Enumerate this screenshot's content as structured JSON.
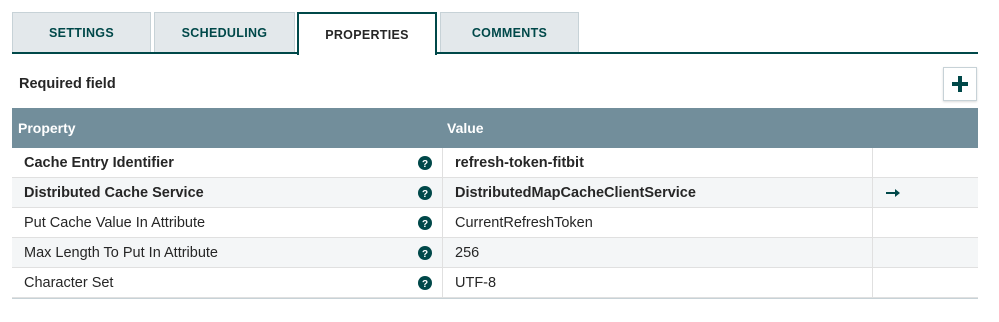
{
  "tabs": [
    {
      "label": "SETTINGS",
      "active": false
    },
    {
      "label": "SCHEDULING",
      "active": false
    },
    {
      "label": "PROPERTIES",
      "active": true
    },
    {
      "label": "COMMENTS",
      "active": false
    }
  ],
  "required_label": "Required field",
  "add_button_icon": "plus-icon",
  "grid": {
    "columns": [
      "Property",
      "Value"
    ],
    "rows": [
      {
        "name": "Cache Entry Identifier",
        "value": "refresh-token-fitbit",
        "required": true,
        "action_icon": null
      },
      {
        "name": "Distributed Cache Service",
        "value": "DistributedMapCacheClientService",
        "required": true,
        "action_icon": "arrow-right-icon"
      },
      {
        "name": "Put Cache Value In Attribute",
        "value": "CurrentRefreshToken",
        "required": false,
        "action_icon": null
      },
      {
        "name": "Max Length To Put In Attribute",
        "value": "256",
        "required": false,
        "action_icon": null
      },
      {
        "name": "Character Set",
        "value": "UTF-8",
        "required": false,
        "action_icon": null
      }
    ]
  },
  "colors": {
    "accent": "#004849",
    "header_bg": "#728e9b",
    "tab_bg": "#e3e8eb"
  }
}
